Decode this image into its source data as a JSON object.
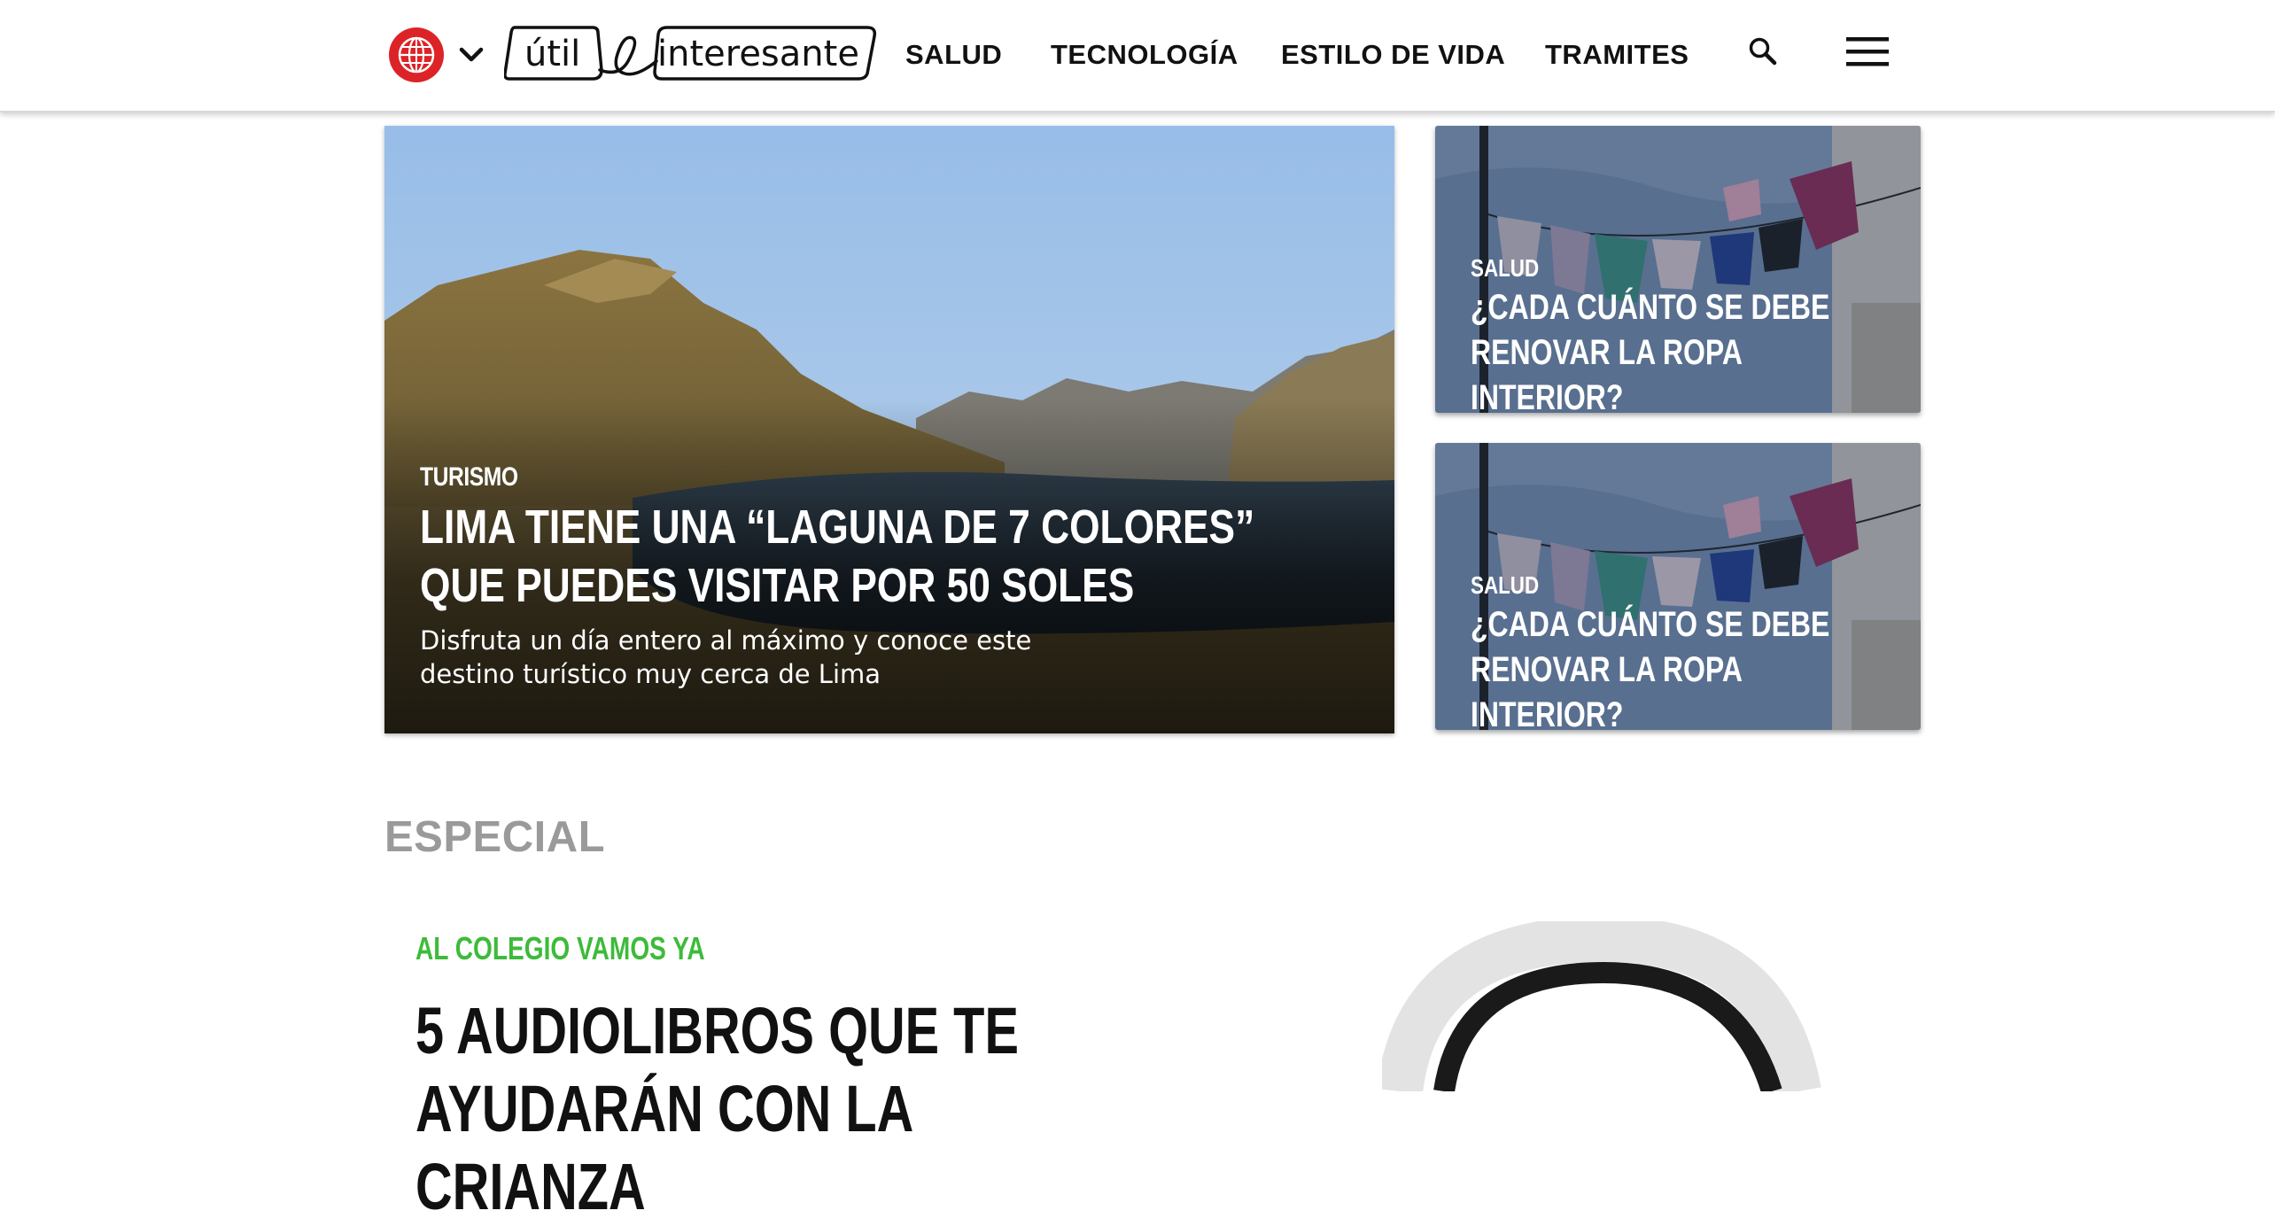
{
  "header": {
    "logo": {
      "part1": "útil",
      "part2": "interesante"
    },
    "nav": [
      "SALUD",
      "TECNOLOGÍA",
      "ESTILO DE VIDA",
      "TRAMITES"
    ],
    "icons": {
      "brand": "globe-icon",
      "dropdown": "chevron-down-icon",
      "search": "search-icon",
      "menu": "hamburger-menu-icon"
    },
    "brand_color": "#dc2327"
  },
  "hero": {
    "category": "TURISMO",
    "title": "LIMA TIENE UNA “LAGUNA DE 7 COLORES” QUE PUEDES VISITAR POR 50 SOLES",
    "description": "Disfruta un día entero al máximo y conoce este destino turístico muy cerca de Lima"
  },
  "side_cards": [
    {
      "category": "SALUD",
      "title": "¿CADA CUÁNTO SE DEBE RENOVAR LA ROPA INTERIOR?"
    },
    {
      "category": "SALUD",
      "title": "¿CADA CUÁNTO SE DEBE RENOVAR LA ROPA INTERIOR?"
    }
  ],
  "especial": {
    "section_title": "ESPECIAL",
    "category": "AL COLEGIO VAMOS YA",
    "title": "5 AUDIOLIBROS QUE TE AYUDARÁN CON LA CRIANZA",
    "category_color": "#3dbb3a"
  }
}
